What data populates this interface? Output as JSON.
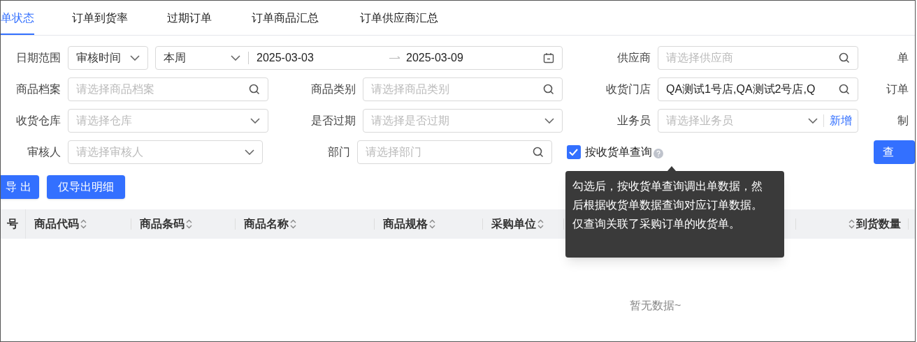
{
  "tabs": [
    {
      "label": "单状态",
      "selected": true
    },
    {
      "label": "订单到货率",
      "selected": false
    },
    {
      "label": "过期订单",
      "selected": false
    },
    {
      "label": "订单商品汇总",
      "selected": false
    },
    {
      "label": "订单供应商汇总",
      "selected": false
    }
  ],
  "filter_rows": [
    [
      {
        "kind": "date_range",
        "label": "日期范围",
        "mode": "审核时间",
        "preset": "本周",
        "start": "2025-03-03",
        "end": "2025-03-09"
      },
      {
        "kind": "search",
        "label": "供应商",
        "placeholder": "请选择供应商"
      },
      {
        "kind": "cut_label",
        "label": "单"
      }
    ],
    [
      {
        "kind": "search",
        "label": "商品档案",
        "placeholder": "请选择商品档案"
      },
      {
        "kind": "search",
        "label": "商品类别",
        "placeholder": "请选择商品类别"
      },
      {
        "kind": "search",
        "label": "收货门店",
        "value": "QA测试1号店,QA测试2号店,Q"
      },
      {
        "kind": "cut_label",
        "label": "订单"
      }
    ],
    [
      {
        "kind": "select",
        "label": "收货仓库",
        "placeholder": "请选择仓库"
      },
      {
        "kind": "select",
        "label": "是否过期",
        "placeholder": "请选择是否过期"
      },
      {
        "kind": "select_add",
        "label": "业务员",
        "placeholder": "请选择业务员",
        "add": "新增"
      },
      {
        "kind": "cut_label",
        "label": "制"
      }
    ],
    [
      {
        "kind": "select",
        "label": "审核人",
        "placeholder": "请选择审核人"
      },
      {
        "kind": "search",
        "label": "部门",
        "placeholder": "请选择部门"
      },
      {
        "kind": "checkbox",
        "label": "按收货单查询",
        "checked": true
      },
      {
        "kind": "button",
        "label": "查"
      }
    ]
  ],
  "actions": [
    "导 出",
    "仅导出明细"
  ],
  "table": {
    "columns": [
      {
        "label": "号",
        "kind": "index"
      },
      {
        "label": "商品代码",
        "kind": "text"
      },
      {
        "label": "商品条码",
        "kind": "text"
      },
      {
        "label": "商品名称",
        "kind": "text"
      },
      {
        "label": "商品规格",
        "kind": "text"
      },
      {
        "label": "采购单位",
        "kind": "text"
      },
      {
        "kind": "hidden"
      },
      {
        "kind": "hidden"
      },
      {
        "label": "到货数量",
        "kind": "number"
      }
    ],
    "empty_text": "暂无数据~"
  },
  "tooltip": "勾选后，按收货单查询调出单数据，然后根据收货单数据查询对应订单数据。仅查询关联了采购订单的收货单。"
}
